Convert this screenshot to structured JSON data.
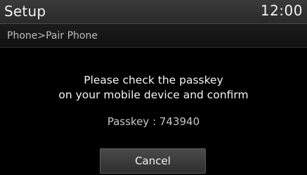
{
  "header": {
    "title": "Setup",
    "time": "12:00"
  },
  "breadcrumb": "Phone>Pair Phone",
  "dialog": {
    "message_line1": "Please check the passkey",
    "message_line2": "on your mobile device and confirm",
    "passkey": "Passkey : 743940",
    "cancel_label": "Cancel"
  },
  "colors": {
    "background": "#000000",
    "titlebar": "#333333",
    "text": "#ffffff",
    "muted_text": "#bdbdbd"
  }
}
